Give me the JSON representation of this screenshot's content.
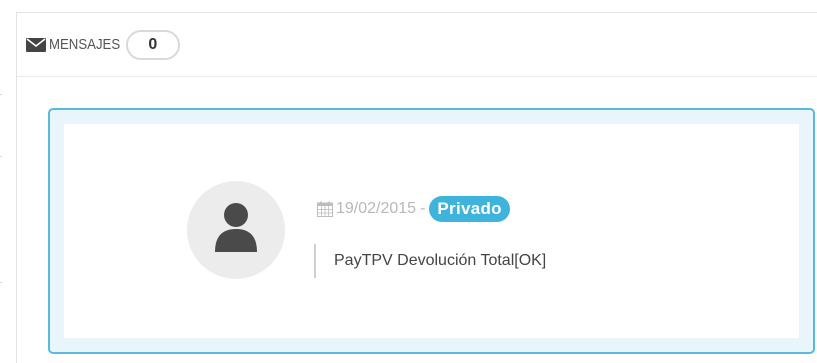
{
  "panel": {
    "heading_icon": "envelope-icon",
    "heading_title": "MENSAJES",
    "message_count": "0"
  },
  "message": {
    "avatar_icon": "user-icon",
    "date_icon": "calendar-icon",
    "date": "19/02/2015",
    "separator": "-",
    "visibility": "Privado",
    "text": "PayTPV Devolución Total[OK]"
  },
  "colors": {
    "card_border": "#5ab9dd",
    "card_background": "#e8f6fc",
    "badge_background": "#3eb4dc",
    "avatar_background": "#ececec"
  }
}
